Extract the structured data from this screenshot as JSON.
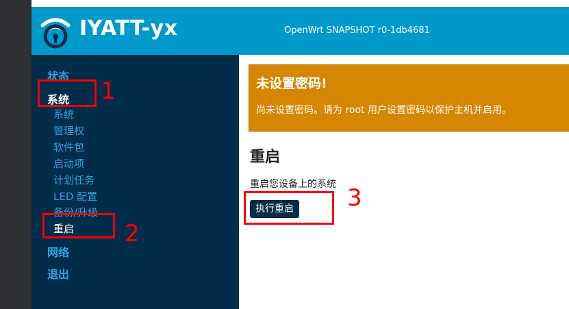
{
  "header": {
    "brand": "IYATT-yx",
    "version": "OpenWrt SNAPSHOT r0-1db4681",
    "logo_icon": "wifi-logo-icon"
  },
  "sidebar": {
    "status": "状态",
    "system": "系统",
    "system_items": [
      "系统",
      "管理权",
      "软件包",
      "启动项",
      "计划任务",
      "LED 配置",
      "备份/升级",
      "重启"
    ],
    "network": "网络",
    "logout": "退出"
  },
  "alert": {
    "title": "未设置密码!",
    "message": "尚未设置密码。请为 root 用户设置密码以保护主机并启用。"
  },
  "main": {
    "title": "重启",
    "description": "重启您设备上的系统",
    "reboot_button": "执行重启"
  },
  "annotations": [
    "1",
    "2",
    "3"
  ],
  "colors": {
    "header_bg": "#0099cc",
    "sidebar_bg": "#012c4a",
    "alert_bg": "#d68600",
    "annotation": "#ff0000"
  }
}
